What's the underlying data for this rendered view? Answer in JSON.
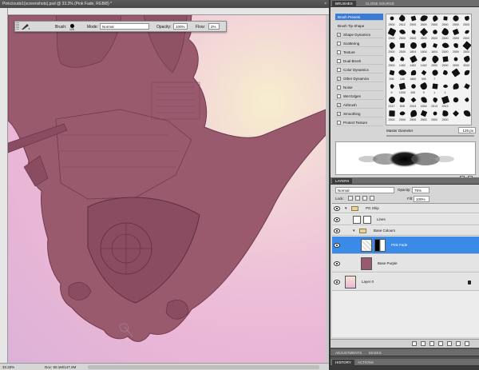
{
  "document": {
    "title": "Pinkclouds1(screenshots).psd @ 33.3% (Pink Fade, RGB/8) *",
    "close_glyph": "×",
    "zoom": "33.33%",
    "doc_info": "Doc: 50.1M/147.2M"
  },
  "options_bar": {
    "brush_label": "Brush:",
    "brush_size": "125",
    "mode_label": "Mode:",
    "mode_value": "Normal",
    "opacity_label": "Opacity:",
    "opacity_value": "100%",
    "flow_label": "Flow:",
    "flow_value": "2%"
  },
  "brushes_panel": {
    "tabs": [
      "BRUSHES",
      "CLONE SOURCE"
    ],
    "list": [
      {
        "label": "Brush Presets",
        "selected": true,
        "checkbox": false
      },
      {
        "label": "Brush Tip Shape",
        "selected": false,
        "checkbox": false
      },
      {
        "label": "Shape Dynamics",
        "checked": true,
        "checkbox": true
      },
      {
        "label": "Scattering",
        "checked": false,
        "checkbox": true
      },
      {
        "label": "Texture",
        "checked": false,
        "checkbox": true
      },
      {
        "label": "Dual Brush",
        "checked": false,
        "checkbox": true
      },
      {
        "label": "Color Dynamics",
        "checked": false,
        "checkbox": true
      },
      {
        "label": "Other Dynamics",
        "checked": true,
        "checkbox": true
      },
      {
        "label": "Noise",
        "checked": false,
        "checkbox": true
      },
      {
        "label": "Wet Edges",
        "checked": false,
        "checkbox": true
      },
      {
        "label": "Airbrush",
        "checked": true,
        "checkbox": true
      },
      {
        "label": "Smoothing",
        "checked": true,
        "checkbox": true
      },
      {
        "label": "Protect Texture",
        "checked": false,
        "checkbox": true
      }
    ],
    "preset_numbers": [
      "2500",
      "2512",
      "2500",
      "2500",
      "2500",
      "2500",
      "2500",
      "2500",
      "2500",
      "2500",
      "2500",
      "2500",
      "2500",
      "2500",
      "2500",
      "2500",
      "2500",
      "2500",
      "1804",
      "1804",
      "1604",
      "2500",
      "2500",
      "2500",
      "2500",
      "1452",
      "1452",
      "1452",
      "2500",
      "2500",
      "3000",
      "3000",
      "596",
      "100",
      "1860",
      "395",
      "7",
      "",
      "",
      "",
      "9",
      "1000",
      "455",
      "9",
      "1",
      "1",
      "",
      "",
      "2317",
      "806",
      "2004",
      "1664",
      "2513",
      "2513",
      "",
      "",
      "2500",
      "2500",
      "2500",
      "2500",
      "2500",
      "2500",
      "",
      ""
    ],
    "master_diameter_label": "Master Diameter",
    "master_diameter_value": "125 px"
  },
  "layers_panel": {
    "tab": "LAYERS",
    "blend_mode": "Normal",
    "opacity_label": "Opacity:",
    "opacity_value": "75%",
    "lock_label": "Lock:",
    "fill_label": "Fill:",
    "fill_value": "100%",
    "layers": [
      {
        "name": "PG Ship",
        "kind": "group",
        "indent": 0
      },
      {
        "name": "Lines",
        "kind": "layer",
        "indent": 1
      },
      {
        "name": "Base Colours",
        "kind": "group",
        "indent": 1
      },
      {
        "name": "Pink Fade",
        "kind": "layer",
        "indent": 2,
        "selected": true
      },
      {
        "name": "Base Purple",
        "kind": "layer",
        "indent": 2
      },
      {
        "name": "Layer 0",
        "kind": "layer",
        "indent": 0,
        "locked": true
      }
    ]
  },
  "adjustments_tabs": [
    "ADJUSTMENTS",
    "MASKS"
  ],
  "history_tabs": [
    "HISTORY",
    "ACTIONS"
  ],
  "colors": {
    "ship": "#9a5a6e",
    "ship_line": "#6e3a4e",
    "sky_pink": "#edbfd8",
    "selection_blue": "#3a8be8"
  }
}
